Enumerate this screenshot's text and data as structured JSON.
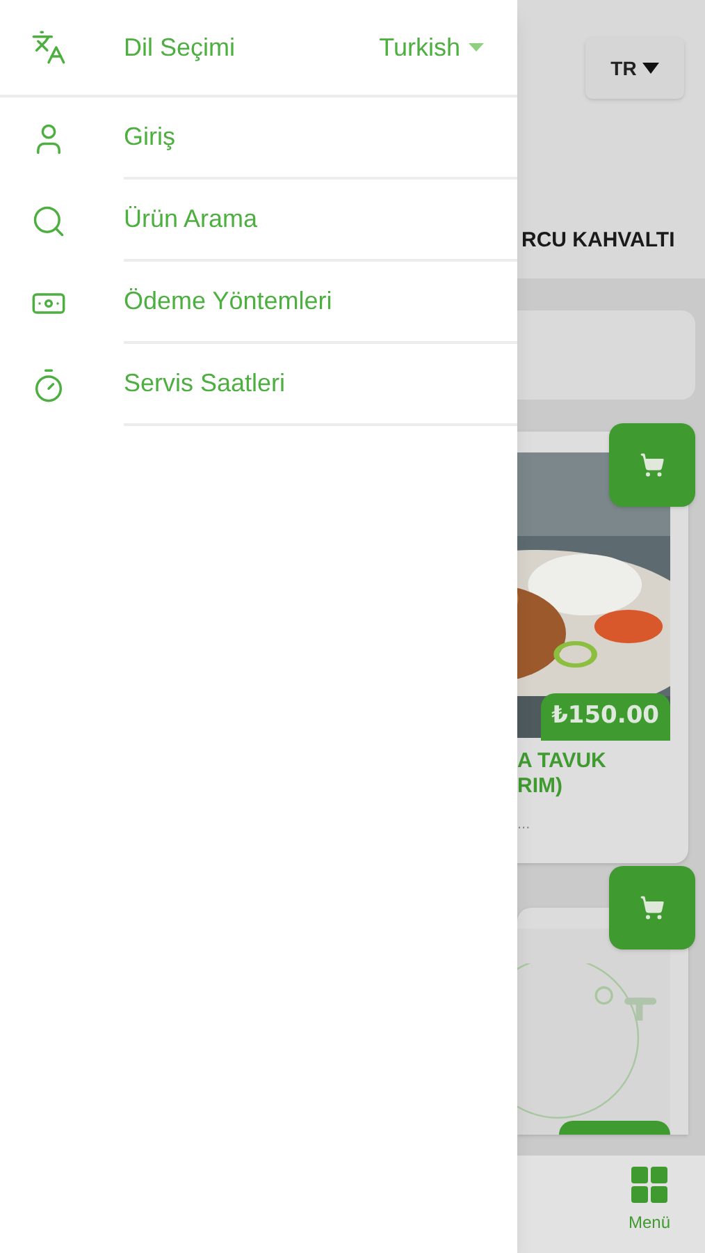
{
  "drawer": {
    "language": {
      "label": "Dil Seçimi",
      "value": "Turkish"
    },
    "items": [
      {
        "label": "Giriş"
      },
      {
        "label": "Ürün Arama"
      },
      {
        "label": "Ödeme Yöntemleri"
      },
      {
        "label": "Servis Saatleri"
      }
    ]
  },
  "page": {
    "language_button": "TR",
    "category": "RCU KAHVALTI",
    "products": [
      {
        "price": "₺150.00",
        "name_lines": [
          "A TAVUK",
          "RIM)"
        ],
        "description": "..."
      },
      {
        "kind": "logo"
      }
    ],
    "bottom_nav": [
      {
        "label": "Menü",
        "selected": true
      }
    ]
  }
}
